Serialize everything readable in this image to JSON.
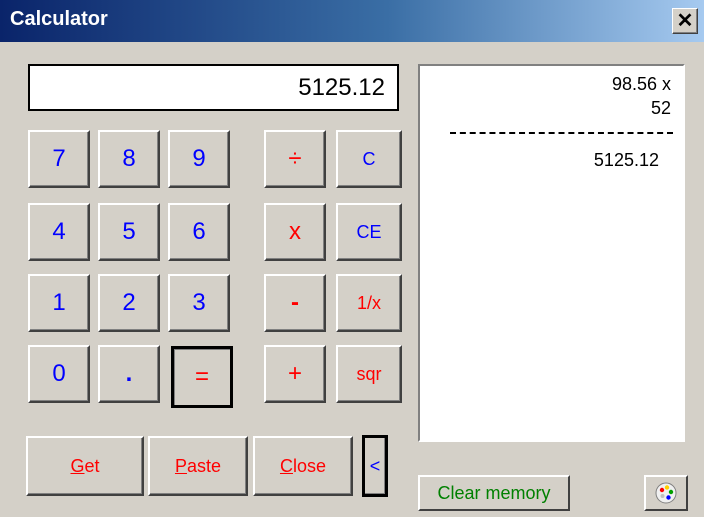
{
  "window": {
    "title": "Calculator",
    "close_glyph": "✕"
  },
  "display": {
    "value": "5125.12"
  },
  "tape": {
    "lines": [
      "98.56 x",
      "52"
    ],
    "separator": "----------------------------",
    "result": "5125.12"
  },
  "keypad": {
    "digits": [
      "7",
      "8",
      "9",
      "4",
      "5",
      "6",
      "1",
      "2",
      "3",
      "0",
      "."
    ],
    "equals": "=",
    "divide": "÷",
    "multiply": "x",
    "minus": "-",
    "plus": "+",
    "clear": "C",
    "clear_entry": "CE",
    "reciprocal": "1/x",
    "sqrt": "sqr"
  },
  "actions": {
    "get": {
      "mnemonic": "G",
      "rest": "et"
    },
    "paste": {
      "mnemonic": "P",
      "rest": "aste"
    },
    "close": {
      "mnemonic": "C",
      "rest": "lose"
    },
    "collapse": "<"
  },
  "footer": {
    "clear_memory": "Clear memory"
  },
  "colors": {
    "digit": "#0000ff",
    "operator": "#ff0000",
    "clear_memory": "#008000"
  }
}
